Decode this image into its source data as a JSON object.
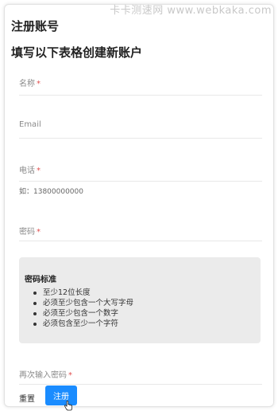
{
  "watermark": "卡卡测速网 www.webkaka.com",
  "form": {
    "title": "注册账号",
    "subtitle": "填写以下表格创建新账户",
    "required_mark": "*",
    "name": {
      "label": "名称",
      "value": ""
    },
    "email": {
      "label": "Email",
      "value": ""
    },
    "phone": {
      "label": "电话",
      "hint": "如：13800000000",
      "value": ""
    },
    "password": {
      "label": "密码",
      "value": ""
    },
    "password_rules": {
      "title": "密码标准",
      "items": [
        "至少12位长度",
        "必须至少包含一个大写字母",
        "必须至少包含一个数字",
        "必须包含至少一个字符"
      ]
    },
    "confirm_password": {
      "label": "再次输入密码",
      "value": ""
    },
    "reset_label": "重置",
    "submit_label": "注册"
  },
  "colors": {
    "accent": "#1a8cff",
    "required": "#e05050",
    "rules_background": "#ebebeb"
  },
  "icons": {
    "cursor": "hand-pointer-icon"
  }
}
